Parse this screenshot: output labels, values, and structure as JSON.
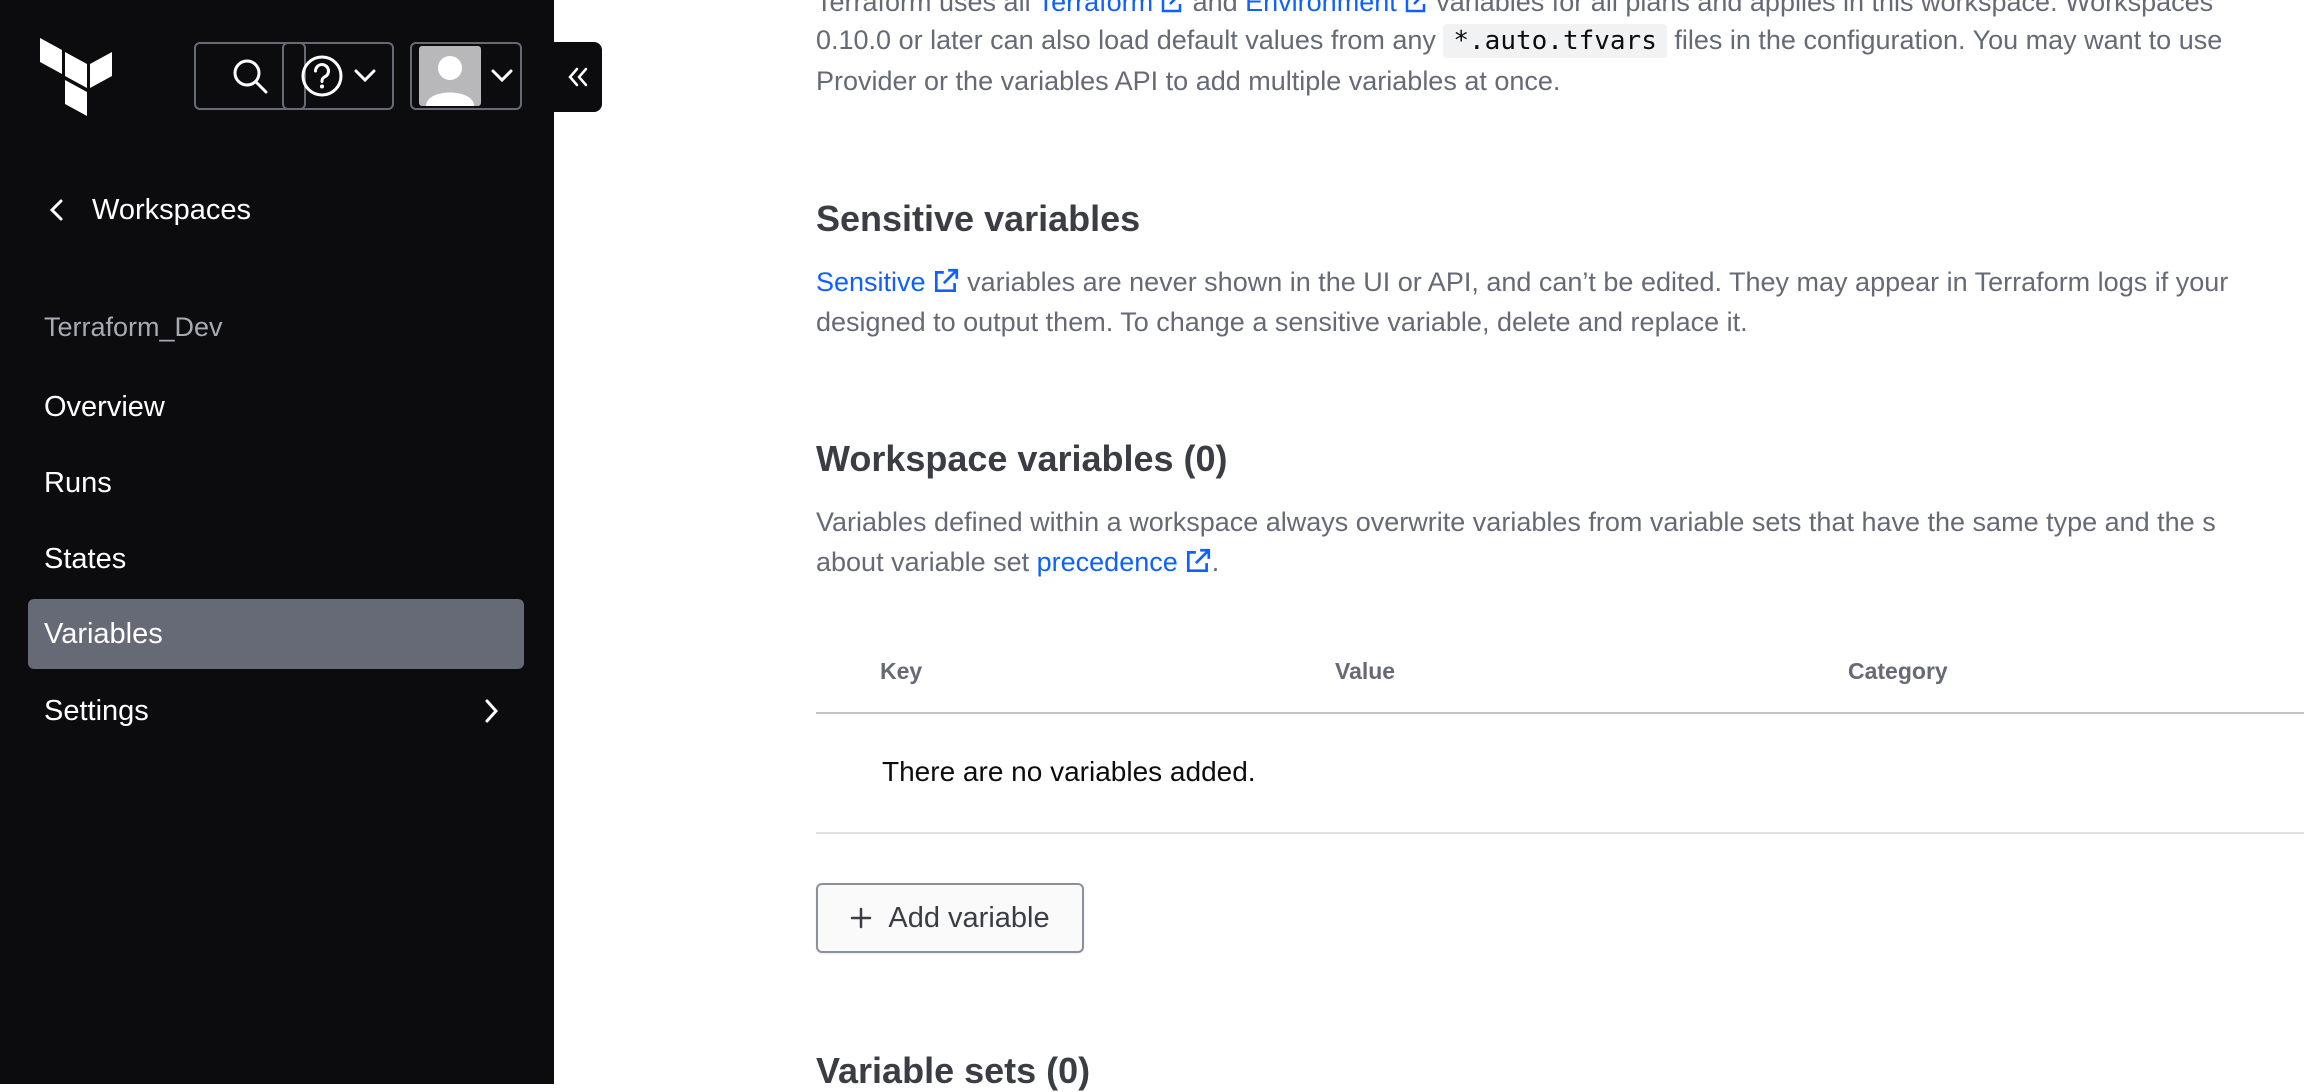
{
  "sidebar": {
    "top_icons": {
      "logo": "terraform-logo",
      "search": "search-icon",
      "help": "help-icon",
      "user": "user-avatar"
    },
    "back_label": "Workspaces",
    "org_name": "Terraform_Dev",
    "items": [
      {
        "label": "Overview"
      },
      {
        "label": "Runs"
      },
      {
        "label": "States"
      },
      {
        "label": "Variables"
      },
      {
        "label": "Settings"
      }
    ]
  },
  "main": {
    "intro": {
      "line1_prefix": "Terraform uses all ",
      "link1": "Terraform",
      "line1_mid": " and ",
      "link2": "Environment",
      "line1_suffix": " variables for all plans and applies in this workspace. Workspaces",
      "line2_prefix": "0.10.0 or later can also load default values from any ",
      "code": "*.auto.tfvars",
      "line2_suffix": " files in the configuration. You may want to use",
      "line3": "Provider or the variables API to add multiple variables at once."
    },
    "sensitive": {
      "heading": "Sensitive variables",
      "link": "Sensitive",
      "line1_suffix": " variables are never shown in the UI or API, and can’t be edited. They may appear in Terraform logs if your",
      "line2": "designed to output them. To change a sensitive variable, delete and replace it."
    },
    "workspace_vars": {
      "heading": "Workspace variables (0)",
      "line1": "Variables defined within a workspace always overwrite variables from variable sets that have the same type and the s",
      "line2_prefix": "about variable set ",
      "link": "precedence",
      "line2_suffix": ".",
      "columns": [
        "Key",
        "Value",
        "Category"
      ],
      "empty_text": "There are no variables added.",
      "add_button": "Add variable"
    },
    "variable_sets": {
      "heading": "Variable sets (0)"
    }
  },
  "colors": {
    "sidebar_bg": "#0c0c0e",
    "active_item_bg": "#656a76",
    "link": "#1060ff",
    "heading": "#3b3d45",
    "body_text": "#656a76"
  }
}
